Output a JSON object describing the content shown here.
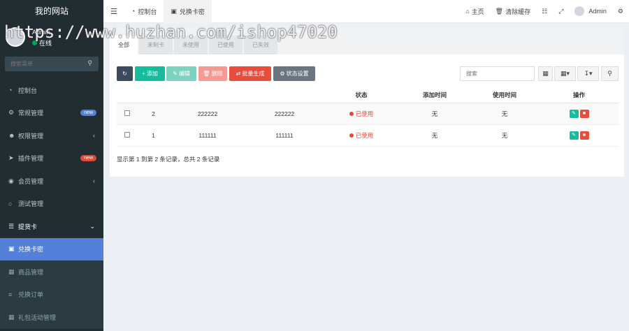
{
  "brand": "我的网站",
  "user": {
    "name": "Admin",
    "status": "在线"
  },
  "search": {
    "placeholder": "搜索菜单"
  },
  "menu": [
    {
      "label": "控制台",
      "icon": "dashboard-icon"
    },
    {
      "label": "常规管理",
      "icon": "cogs-icon",
      "badge": "new",
      "badge_color": "#5480d8"
    },
    {
      "label": "权限管理",
      "icon": "group-icon",
      "chevron": "‹"
    },
    {
      "label": "插件管理",
      "icon": "rocket-icon",
      "badge": "new",
      "badge_color": "#dd4b39"
    },
    {
      "label": "会员管理",
      "icon": "user-circle-icon",
      "chevron": "‹"
    },
    {
      "label": "测试管理",
      "icon": "circle-icon"
    },
    {
      "label": "提货卡",
      "icon": "list-icon",
      "chevron": "⌄"
    },
    {
      "label": "兑换卡密",
      "icon": "credit-card-icon"
    },
    {
      "label": "商品管理",
      "icon": "building-icon"
    },
    {
      "label": "兑换订单",
      "icon": "bars-icon"
    },
    {
      "label": "礼包活动管理",
      "icon": "th-large-icon"
    }
  ],
  "topbar": {
    "tabs": [
      {
        "label": "控制台",
        "icon": "dashboard-icon"
      },
      {
        "label": "兑换卡密",
        "icon": "credit-card-icon"
      }
    ],
    "right": [
      {
        "label": "主页",
        "icon": "home-icon"
      },
      {
        "label": "清除缓存",
        "icon": "trash-icon"
      },
      {
        "label": "",
        "icon": "language-icon"
      },
      {
        "label": "",
        "icon": "expand-icon"
      },
      {
        "label": "Admin",
        "icon": "avatar"
      },
      {
        "label": "",
        "icon": "gears-icon"
      }
    ],
    "menu_toggle_icon": "bars-icon"
  },
  "status_tabs": [
    "全部",
    "未制卡",
    "未使用",
    "已使用",
    "已失效"
  ],
  "toolbar": {
    "refresh_icon": "refresh-icon",
    "add": "添加",
    "edit": "编辑",
    "delete": "删除",
    "batch": "批量生成",
    "status_setting": "状态设置",
    "search_placeholder": "搜索"
  },
  "table": {
    "headers": [
      "",
      "",
      "",
      "",
      "状态",
      "添加时间",
      "使用时间",
      "操作"
    ],
    "rows": [
      {
        "id": "2",
        "card": "222222",
        "password": "222222",
        "status": "已使用",
        "add_time": "无",
        "use_time": "无"
      },
      {
        "id": "1",
        "card": "111111",
        "password": "111111",
        "status": "已使用",
        "add_time": "无",
        "use_time": "无"
      }
    ]
  },
  "summary": "显示第 1 到第 2 条记录，总共 2 条记录",
  "colors": {
    "sidebar_bg": "#222d32",
    "active_menu": "#5480d8",
    "primary_dark": "#3c4a5e",
    "success": "#18bc9c",
    "success_light": "#7ed3c0",
    "danger_light": "#f29b92",
    "danger": "#e74c3c",
    "gray": "#6b7580"
  },
  "watermark": "https://www.huzhan.com/ishop47020"
}
